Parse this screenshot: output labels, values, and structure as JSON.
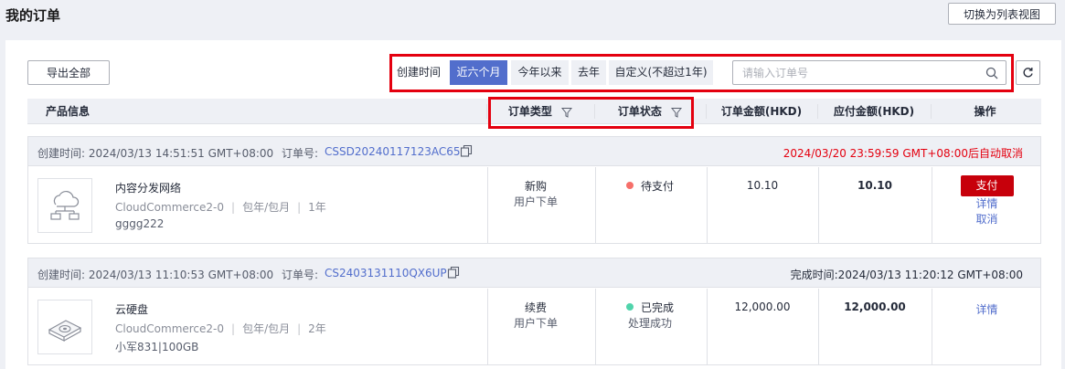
{
  "page": {
    "title": "我的订单",
    "switch_view_label": "切换为列表视图"
  },
  "toolbar": {
    "export_label": "导出全部",
    "created_time_label": "创建时间",
    "time_options": [
      "近六个月",
      "今年以来",
      "去年",
      "自定义(不超过1年)"
    ],
    "time_selected": "近六个月",
    "search_placeholder": "请输入订单号"
  },
  "table": {
    "headers": {
      "product": "产品信息",
      "order_type": "订单类型",
      "order_status": "订单状态",
      "order_amount": "订单金额(HKD)",
      "payable_amount": "应付金额(HKD)",
      "actions": "操作"
    }
  },
  "orders": [
    {
      "created_label": "创建时间:",
      "created": "2024/03/13 14:51:51 GMT+08:00",
      "order_no_label": "订单号:",
      "order_no": "CSSD20240117123AC65",
      "right_note": "2024/03/20 23:59:59 GMT+08:00后自动取消",
      "right_note_color": "#e4000f",
      "product_name": "内容分发网络",
      "product_vendor": "CloudCommerce2-0",
      "billing": "包年/包月",
      "duration": "1年",
      "extra": "gggg222",
      "icon": "cloud-network-icon",
      "type": "新购",
      "type_sub": "用户下单",
      "status": "待支付",
      "status_sub": "",
      "status_color": "#f66f6a",
      "amount": "10.10",
      "payable": "10.10",
      "pay_label": "支付",
      "detail_label": "详情",
      "cancel_label": "取消"
    },
    {
      "created_label": "创建时间:",
      "created": "2024/03/13 11:10:53 GMT+08:00",
      "order_no_label": "订单号:",
      "order_no": "CS2403131110QX6UP",
      "right_note": "完成时间:2024/03/13 11:20:12 GMT+08:00",
      "right_note_color": "#252b3a",
      "product_name": "云硬盘",
      "product_vendor": "CloudCommerce2-0",
      "billing": "包年/包月",
      "duration": "2年",
      "extra": "小军831|100GB",
      "icon": "disk-icon",
      "type": "续费",
      "type_sub": "用户下单",
      "status": "已完成",
      "status_sub": "处理成功",
      "status_color": "#50d4ab",
      "amount": "12,000.00",
      "payable": "12,000.00",
      "detail_label": "详情"
    }
  ]
}
